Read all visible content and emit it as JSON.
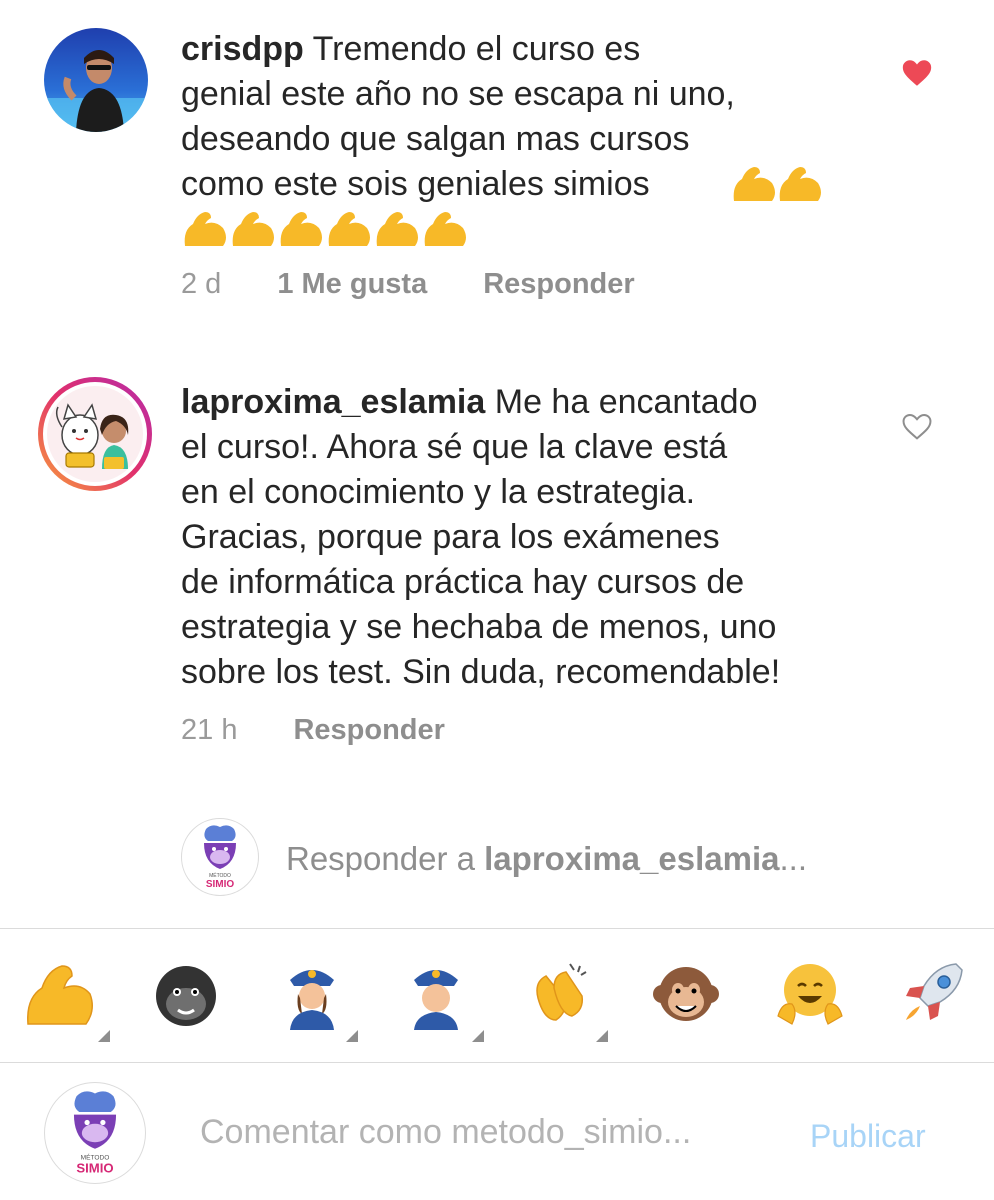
{
  "comments": [
    {
      "username": "crisdpp",
      "text_lines": [
        "Tremendo el curso es",
        "genial este año no se escapa ni uno,",
        "deseando que salgan mas cursos",
        "como este sois geniales simios"
      ],
      "time": "2 d",
      "likes": "1 Me gusta",
      "reply_label": "Responder",
      "liked": true
    },
    {
      "username": "laproxima_eslamia",
      "text_lines": [
        "Me ha encantado",
        "el curso!. Ahora sé que la clave está",
        "en el conocimiento y la estrategia.",
        "Gracias, porque para los exámenes",
        "de informática práctica hay cursos de",
        "estrategia y se hechaba de menos, uno",
        "sobre los test. Sin duda, recomendable!"
      ],
      "time": "21 h",
      "reply_label": "Responder",
      "liked": false
    }
  ],
  "reply_box": {
    "prefix": "Responder a",
    "target": "laproxima_eslamia",
    "suffix": "..."
  },
  "emoji_bar": [
    "flexed-biceps",
    "gorilla",
    "police-officer-woman",
    "police-officer-man",
    "clapping-hands",
    "monkey-face",
    "hugging-face",
    "rocket"
  ],
  "comment_box": {
    "placeholder": "Comentar como metodo_simio...",
    "publish_label": "Publicar"
  },
  "logo": {
    "top_text": "MÉTODO",
    "bottom_text": "SIMIO"
  },
  "colors": {
    "heart_red": "#ed4956",
    "publish_disabled": "#a8d4f7",
    "text": "#262626",
    "secondary": "#8e8e8e"
  }
}
